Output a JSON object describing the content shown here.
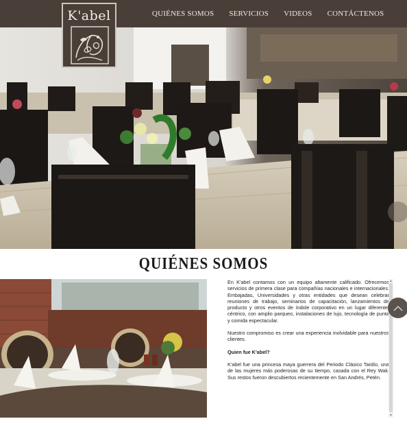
{
  "logo": {
    "text": "K'abel"
  },
  "nav": {
    "items": [
      {
        "label": "QUIÉNES SOMOS"
      },
      {
        "label": "SERVICIOS"
      },
      {
        "label": "VIDEOS"
      },
      {
        "label": "CONTÁCTENOS"
      }
    ]
  },
  "about": {
    "title": "QUIÉNES SOMOS",
    "paragraph1": "En K'abel contamos con un equipo altamente calificado. Ofrecemos servicios de primera clase para compañías nacionales e internacionales. Embajadas, Universidades y otras entidades que desean celebrar reuniones de trabajo, seminarios de capacitación, lanzamientos de producto y otros eventos de índole corporativo en un lugar diferente, céntrico, con amplio parqueo, instalaciones de lujo, tecnología de punta y comida espectacular.",
    "paragraph2": "Nuestro compromiso es crear una experiencia inolvidable para nuestros clientes.",
    "question": "Quien fue K'abel?",
    "paragraph3": "K'abel fue una princesa maya guerrera del Periodo Clásico Tardío, una de las mujeres más poderosas de su tiempo, casada con el Rey Wak. Sus restos fueron descubiertos recientemente en San Andrés, Petén."
  },
  "colors": {
    "header": "#4a3f38",
    "accent_button": "#5a524c"
  },
  "icons": {
    "scroll_up": "chevron-up-icon",
    "slider_handle": "chevron-up-icon"
  }
}
